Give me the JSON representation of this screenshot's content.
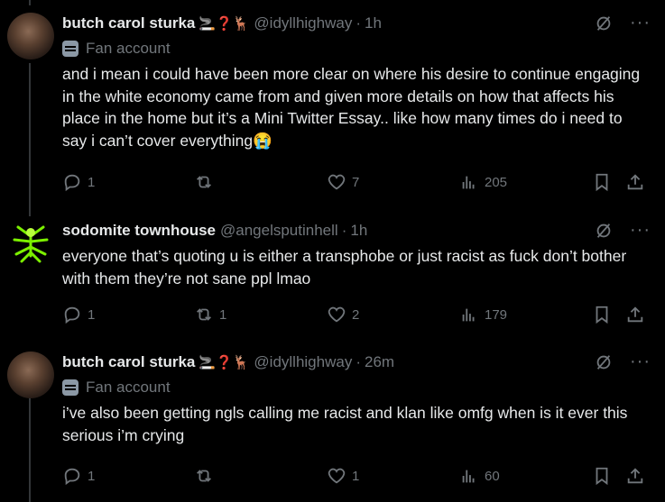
{
  "tweets": [
    {
      "name": "butch carol sturka",
      "emoji": "🚬❓🦌",
      "handle": "@idyllhighway",
      "time": "1h",
      "subline": "Fan account",
      "text": "and i mean i could have been more clear on where his desire to continue engaging in the white economy came from and given more details on how that affects his place in the home but it’s a Mini Twitter Essay.. like how many times do i need to say i can’t cover everything😭",
      "replies": "1",
      "retweets": "",
      "likes": "7",
      "views": "205"
    },
    {
      "name": "sodomite townhouse",
      "emoji": "",
      "handle": "@angelsputinhell",
      "time": "1h",
      "subline": "",
      "text": "everyone that’s quoting u is either a transphobe or just racist as fuck don’t bother with them they’re not sane ppl lmao",
      "replies": "1",
      "retweets": "1",
      "likes": "2",
      "views": "179"
    },
    {
      "name": "butch carol sturka",
      "emoji": "🚬❓🦌",
      "handle": "@idyllhighway",
      "time": "26m",
      "subline": "Fan account",
      "text": "i’ve also been getting ngls calling me racist and klan like omfg when is it ever this serious i’m crying",
      "replies": "1",
      "retweets": "",
      "likes": "1",
      "views": "60"
    }
  ],
  "icons": {
    "reply": "reply-icon",
    "retweet": "retweet-icon",
    "like": "heart-icon",
    "views": "views-icon",
    "bookmark": "bookmark-icon",
    "share": "share-icon",
    "grok": "grok-icon",
    "more": "more-icon"
  }
}
